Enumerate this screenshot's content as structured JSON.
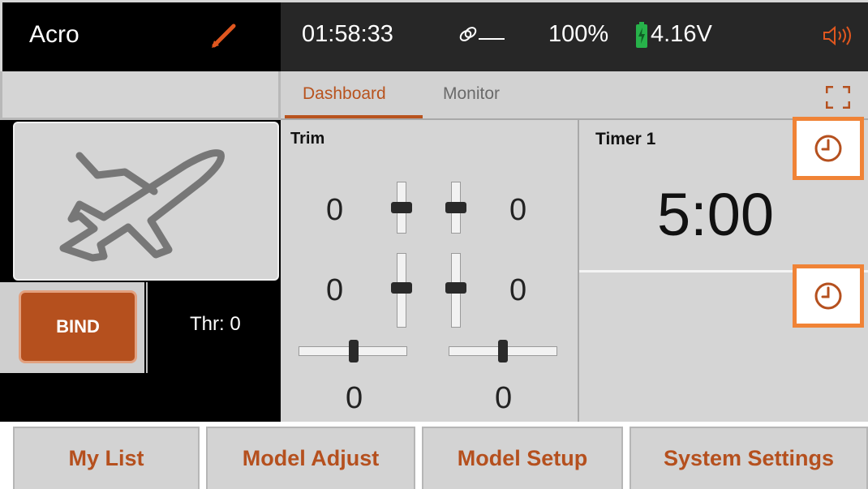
{
  "header": {
    "model_name": "Acro",
    "clock": "01:58:33",
    "battery_percent": "100%",
    "voltage": "4.16V"
  },
  "tabs": [
    {
      "label": "Dashboard",
      "active": true
    },
    {
      "label": "Monitor",
      "active": false
    }
  ],
  "left": {
    "bind_label": "BIND",
    "throttle_label": "Thr: 0"
  },
  "trim": {
    "title": "Trim",
    "left_upper": "0",
    "right_upper": "0",
    "left_lower": "0",
    "right_lower": "0",
    "bottom_left": "0",
    "bottom_right": "0"
  },
  "timer": {
    "title": "Timer 1",
    "value": "5:00"
  },
  "nav": [
    {
      "label": "My List"
    },
    {
      "label": "Model Adjust"
    },
    {
      "label": "Model Setup"
    },
    {
      "label": "System Settings"
    }
  ],
  "icons": {
    "edit": "pencil-icon",
    "link": "link-icon",
    "battery": "battery-icon",
    "sound": "speaker-icon",
    "fullscreen": "fullscreen-icon",
    "model": "airplane-icon",
    "timer": "timer-icon"
  },
  "colors": {
    "accent": "#b5501e",
    "highlight": "#f08336",
    "battery": "#27b24a"
  }
}
